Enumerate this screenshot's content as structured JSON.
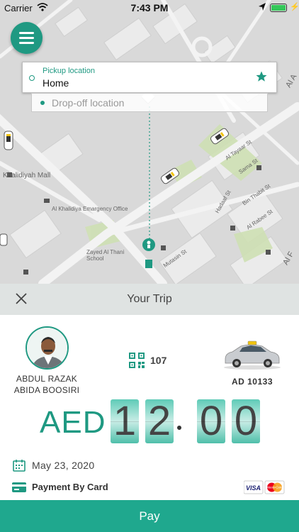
{
  "status_bar": {
    "carrier": "Carrier",
    "time": "7:43 PM"
  },
  "map": {
    "labels": {
      "khalidiyah_mall": "Khalidiyah Mall",
      "emergency_office": "Al Khalidiya Emargency Office",
      "school": "Zayed Al Thani School",
      "street_al_tayaar": "Al Tayaar St",
      "street_sama_st": "Sama St",
      "street_bin_thabit": "Bin Thabit St",
      "street_al_rabee": "Al Rabee St",
      "street_hadaaf": "Hadaaf St",
      "street_mutasin": "Mutasin St",
      "street_al_a": "Al A",
      "street_al_f": "Al F"
    }
  },
  "pickup": {
    "label": "Pickup location",
    "value": "Home"
  },
  "dropoff": {
    "placeholder": "Drop-off location"
  },
  "trip": {
    "title": "Your Trip",
    "driver_name_line1": "ABDUL RAZAK",
    "driver_name_line2": "ABIDA BOOSIRI",
    "driver_number": "107",
    "plate": "AD 10133",
    "currency": "AED",
    "fare_digits": [
      "1",
      "2",
      "0",
      "0"
    ],
    "date": "May 23, 2020",
    "payment_method": "Payment By Card",
    "card_brands": [
      "VISA",
      "MasterCard"
    ]
  },
  "pay_button": "Pay",
  "colors": {
    "accent": "#1f9982",
    "pay_button": "#1fa88e",
    "header_bg": "#dfe3e2"
  }
}
